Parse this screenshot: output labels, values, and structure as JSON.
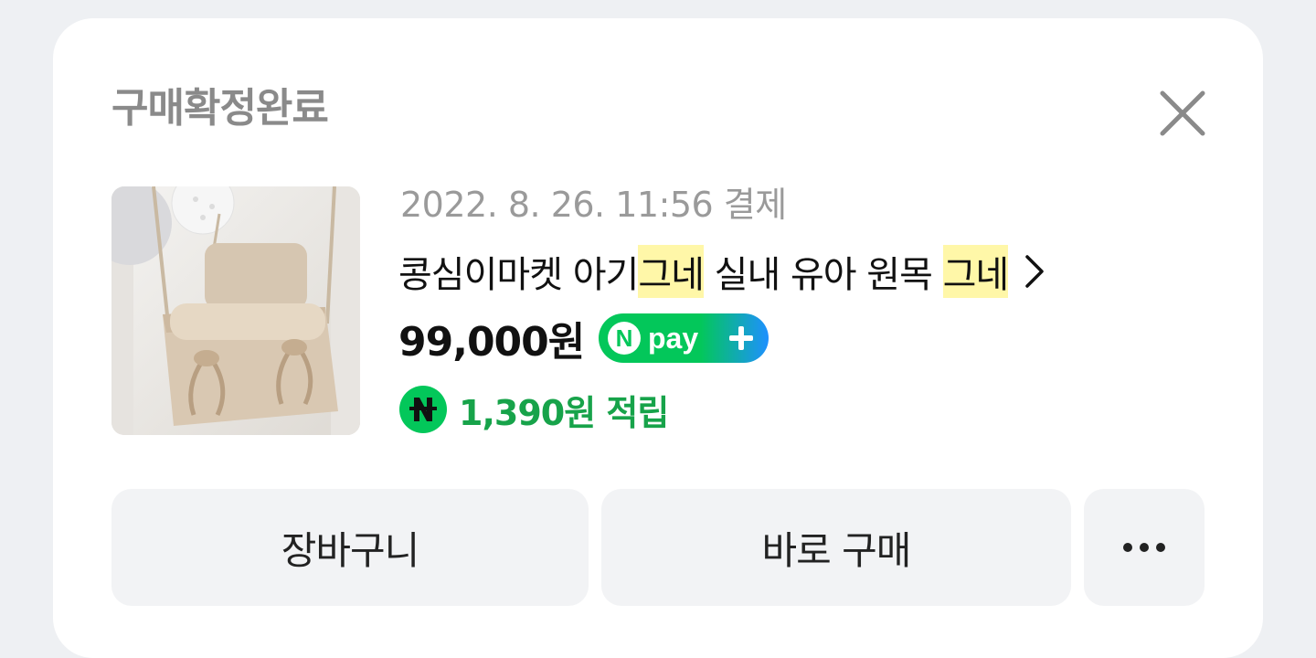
{
  "header": {
    "title": "구매확정완료"
  },
  "product": {
    "image_alt": "아기 그네 상품 사진",
    "date": "2022. 8. 26. 11:56 결제",
    "name_parts": {
      "p1": "콩심이마켓 아기",
      "p2": "그네",
      "p3": " 실내 유아 원목 ",
      "p4": "그네"
    },
    "price": "99,000원",
    "npay_label": "pay",
    "npay_letter": "N",
    "reward": "1,390원 적립"
  },
  "actions": {
    "cart_label": "장바구니",
    "buy_label": "바로 구매",
    "more_label": "•••"
  },
  "colors": {
    "highlight": "#fff7a8",
    "reward_green": "#17a34a",
    "npay_green": "#03c75a",
    "npay_blue": "#1e90ff"
  },
  "icons": {
    "close": "close-icon",
    "chevron": "chevron-right-icon",
    "naver_point": "naver-point-icon",
    "npay_plus": "npay-plus-icon"
  }
}
